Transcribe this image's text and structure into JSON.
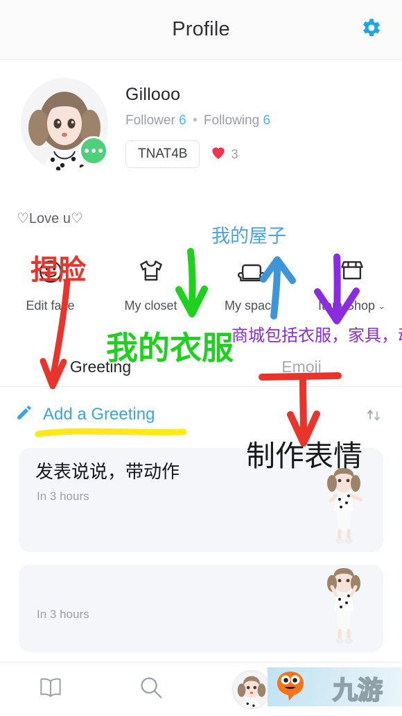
{
  "header": {
    "title": "Profile",
    "gear_icon": "gear-icon",
    "accent_blue": "#1fa6e0"
  },
  "profile": {
    "avatar_icon": "avatar-image",
    "badge_icon": "more-dots-icon",
    "name": "Gillooo",
    "follower_label": "Follower",
    "follower_count": "6",
    "separator": "•",
    "following_label": "Following",
    "following_count": "6",
    "code": "TNAT4B",
    "heart_icon": "heart-icon",
    "heart_count": "3",
    "status_text": "♡Love u♡"
  },
  "menu": {
    "items": [
      {
        "label": "Edit face",
        "icon": "smiley-face-icon",
        "chevron": ""
      },
      {
        "label": "My closet",
        "icon": "tshirt-icon",
        "chevron": ""
      },
      {
        "label": "My space",
        "icon": "sofa-icon",
        "chevron": ""
      },
      {
        "label": "Item Shop",
        "icon": "store-icon",
        "chevron": "⌄"
      }
    ]
  },
  "tabs": [
    {
      "label": "Greeting",
      "active": true
    },
    {
      "label": "Emoji",
      "active": false
    }
  ],
  "greeting_bar": {
    "pencil_icon": "pencil-icon",
    "link_label": "Add a Greeting",
    "sort_icon": "sort-updown-icon"
  },
  "cards": [
    {
      "title": "发表说说，带动作",
      "time": "In 3 hours",
      "figure_icon": "avatar-figure-icon"
    },
    {
      "title": "",
      "time": "In 3 hours",
      "figure_icon": "avatar-figure-icon"
    }
  ],
  "bottom_nav": {
    "items": [
      {
        "icon": "book-icon",
        "label": ""
      },
      {
        "icon": "search-icon",
        "label": ""
      },
      {
        "icon": "profile-avatar-icon",
        "label": ""
      },
      {
        "icon": "shop-icon",
        "label": ""
      }
    ]
  },
  "watermark": {
    "text": "九游",
    "mascot_icon": "mascot-icon",
    "mascot_color": "#f5731a"
  },
  "annotations": [
    {
      "id": "edit-face-note",
      "text": "捏脸",
      "color": "#e8342a",
      "arrow": "down"
    },
    {
      "id": "closet-note",
      "text": "我的衣服",
      "color": "#1fd11f",
      "arrow": "down"
    },
    {
      "id": "space-note",
      "text": "我的屋子",
      "color": "#4aa3dd",
      "arrow": "up"
    },
    {
      "id": "shop-note",
      "text": "商城包括衣服，家具，动作",
      "color": "#8a2be2",
      "arrow": "down"
    },
    {
      "id": "greeting-note",
      "text": "发表说说，带动作",
      "color": "#1a1a1a",
      "arrow": "underline-yellow"
    },
    {
      "id": "emoji-note",
      "text": "制作表情",
      "color": "#1a1a1a",
      "arrow": "down"
    }
  ]
}
